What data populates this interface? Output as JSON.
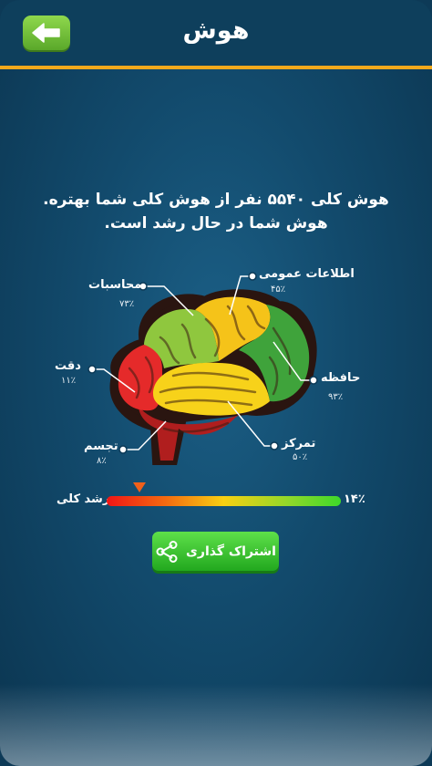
{
  "header": {
    "title": "هوش"
  },
  "message": {
    "line1": "هوش کلی ۵۵۴۰ نفر از هوش کلی شما بهتره.",
    "line2": "هوش شما در حال رشد است."
  },
  "regions": [
    {
      "id": "general",
      "label": "اطلاعات عمومی",
      "percent": "۴۵٪",
      "color": "#f5c319"
    },
    {
      "id": "calc",
      "label": "محاسبات",
      "percent": "۷۳٪",
      "color": "#8fc73e"
    },
    {
      "id": "accuracy",
      "label": "دقت",
      "percent": "۱۱٪",
      "color": "#e52a2a"
    },
    {
      "id": "memory",
      "label": "حافظه",
      "percent": "۹۳٪",
      "color": "#3fa33b"
    },
    {
      "id": "focus",
      "label": "تمرکز",
      "percent": "۵۰٪",
      "color": "#f7d21a"
    },
    {
      "id": "visual",
      "label": "تجسم",
      "percent": "۸٪",
      "color": "#b01e1e"
    }
  ],
  "growth": {
    "label": "رشد کلی",
    "value_text": "۱۴٪",
    "value": 14
  },
  "share": {
    "label": "اشتراک گذاری"
  },
  "colors": {
    "accent": "#f2a91c",
    "button_green": "#3cc636",
    "header_bg": "#0e3f5c"
  }
}
